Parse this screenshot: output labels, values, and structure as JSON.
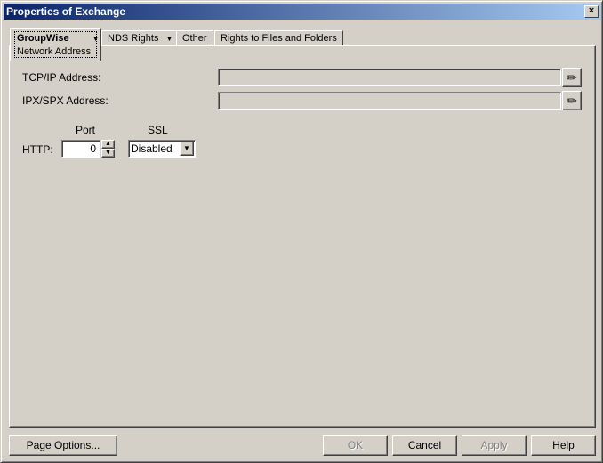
{
  "window": {
    "title": "Properties of Exchange",
    "close": "×"
  },
  "tabs": [
    {
      "label": "GroupWise",
      "sub": "Network Address",
      "caret": "▼"
    },
    {
      "label": "NDS Rights",
      "caret": "▼"
    },
    {
      "label": "Other"
    },
    {
      "label": "Rights to Files and Folders"
    }
  ],
  "form": {
    "tcpip_label": "TCP/IP Address:",
    "tcpip_value": "",
    "ipx_label": "IPX/SPX Address:",
    "ipx_value": "",
    "port_header": "Port",
    "ssl_header": "SSL",
    "http_label": "HTTP:",
    "port_value": "0",
    "ssl_value": "Disabled"
  },
  "buttons": {
    "page_options": "Page Options...",
    "ok": "OK",
    "cancel": "Cancel",
    "apply": "Apply",
    "help": "Help"
  }
}
